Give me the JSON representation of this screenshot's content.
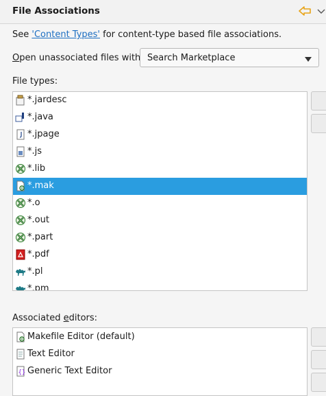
{
  "header": {
    "title": "File Associations",
    "back_icon": "back-arrow-icon",
    "menu_icon": "view-menu-icon"
  },
  "content_types": {
    "prefix": "See ",
    "link": "'Content Types'",
    "suffix": " for content-type based file associations."
  },
  "open_unassociated": {
    "label_mnemonic": "O",
    "label_rest": "pen unassociated files with:",
    "selected": "Search Marketplace"
  },
  "file_types": {
    "label": "File types:",
    "selected_index": 5,
    "items": [
      {
        "label": "*.jardesc",
        "icon": "jar-descriptor-icon"
      },
      {
        "label": "*.java",
        "icon": "java-file-icon"
      },
      {
        "label": "*.jpage",
        "icon": "java-scrapbook-icon"
      },
      {
        "label": "*.js",
        "icon": "javascript-file-icon"
      },
      {
        "label": "*.lib",
        "icon": "binary-file-icon"
      },
      {
        "label": "*.mak",
        "icon": "makefile-icon"
      },
      {
        "label": "*.o",
        "icon": "binary-file-icon"
      },
      {
        "label": "*.out",
        "icon": "binary-file-icon"
      },
      {
        "label": "*.part",
        "icon": "binary-file-icon"
      },
      {
        "label": "*.pdf",
        "icon": "pdf-file-icon"
      },
      {
        "label": "*.pl",
        "icon": "perl-camel-icon"
      },
      {
        "label": "*.pm",
        "icon": "perl-camel-icon"
      }
    ]
  },
  "associated_editors": {
    "label_pre": "Associated ",
    "label_mnemonic": "e",
    "label_post": "ditors:",
    "items": [
      {
        "label": "Makefile Editor (default)",
        "icon": "makefile-editor-icon"
      },
      {
        "label": "Text Editor",
        "icon": "text-editor-icon"
      },
      {
        "label": "Generic Text Editor",
        "icon": "generic-editor-icon"
      }
    ]
  },
  "colors": {
    "selection": "#2a9de0",
    "link": "#1d6fc2",
    "back_arrow": "#e8a317"
  }
}
